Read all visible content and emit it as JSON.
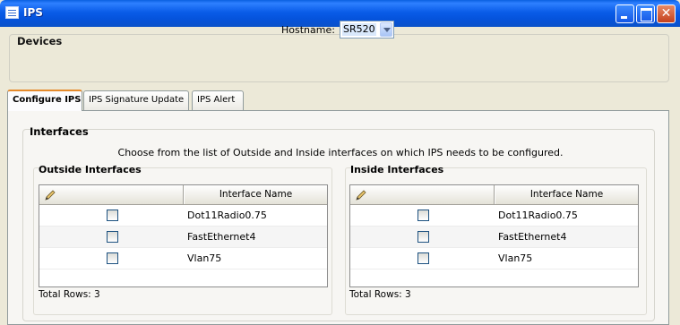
{
  "window": {
    "title": "IPS",
    "icon": "window-icon",
    "controls": [
      "minimize",
      "maximize",
      "close"
    ]
  },
  "devices": {
    "title": "Devices",
    "hostname_label": "Hostname:",
    "hostname_value": "SR520"
  },
  "tabs": [
    {
      "label": "Configure IPS",
      "active": true
    },
    {
      "label": "IPS Signature Update",
      "active": false
    },
    {
      "label": "IPS Alert",
      "active": false
    }
  ],
  "interfaces": {
    "title": "Interfaces",
    "instruction": "Choose from the list of Outside and Inside interfaces on which IPS needs to be configured.",
    "outside": {
      "title": "Outside Interfaces",
      "column_header": "Interface Name",
      "header_icon": "pencil-icon",
      "rows": [
        {
          "checked": false,
          "name": "Dot11Radio0.75"
        },
        {
          "checked": false,
          "name": "FastEthernet4"
        },
        {
          "checked": false,
          "name": "Vlan75"
        }
      ],
      "total_rows": "Total Rows: 3"
    },
    "inside": {
      "title": "Inside Interfaces",
      "column_header": "Interface Name",
      "header_icon": "pencil-icon",
      "rows": [
        {
          "checked": false,
          "name": "Dot11Radio0.75"
        },
        {
          "checked": false,
          "name": "FastEthernet4"
        },
        {
          "checked": false,
          "name": "Vlan75"
        }
      ],
      "total_rows": "Total Rows: 3"
    }
  },
  "colors": {
    "titlebar": "#0a5ce8",
    "tab_active_accent": "#e68b2c",
    "background": "#ece9d8"
  }
}
